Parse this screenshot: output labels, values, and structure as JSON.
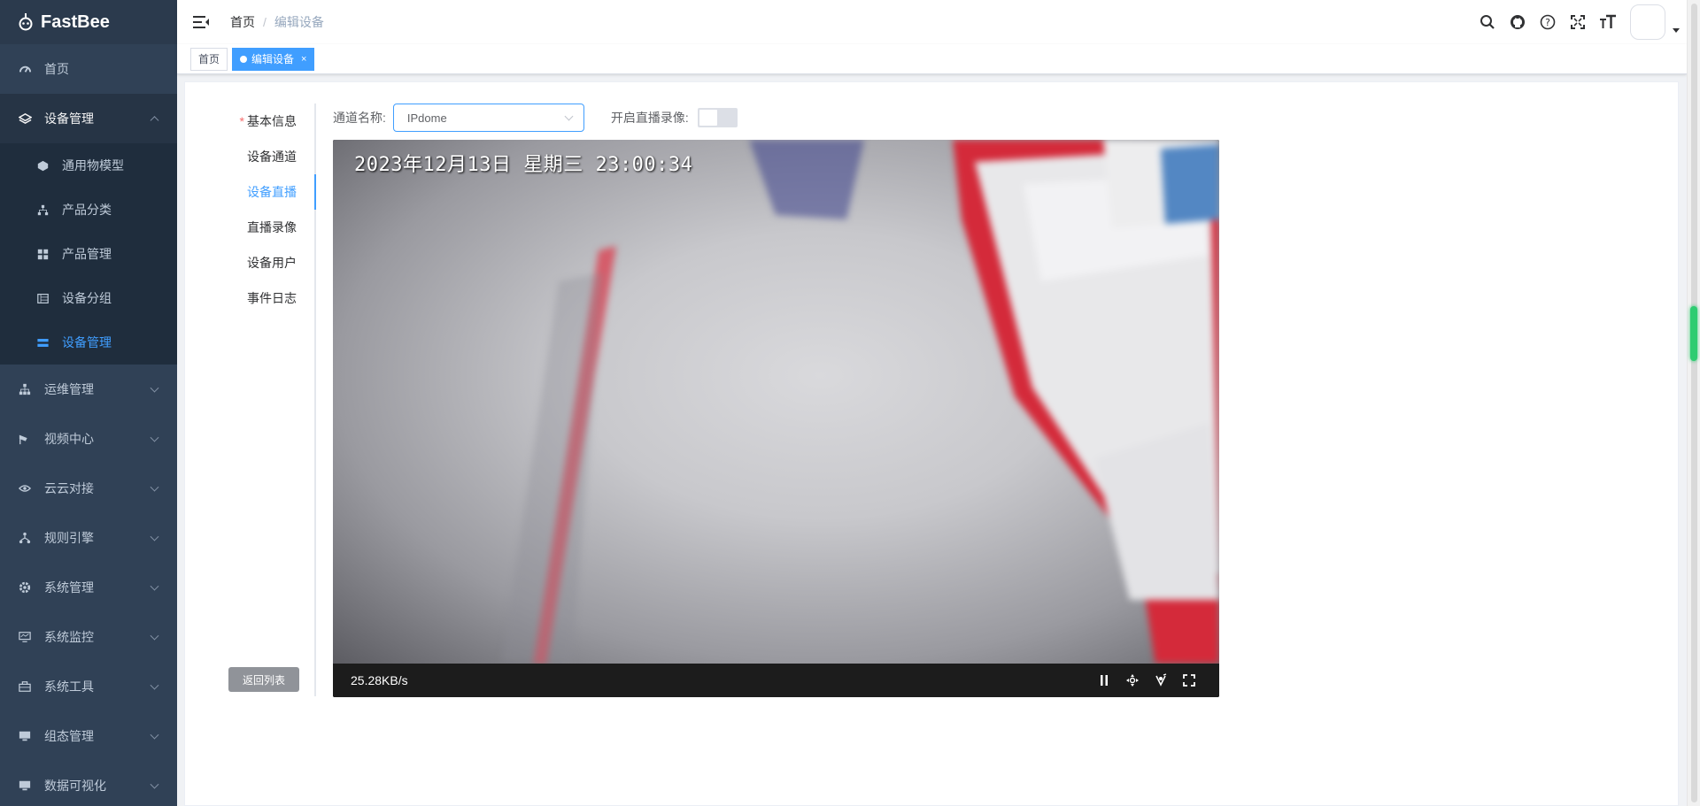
{
  "app": {
    "name": "FastBee"
  },
  "sidebar": {
    "items": [
      {
        "label": "首页",
        "icon": "dashboard-icon"
      },
      {
        "label": "设备管理",
        "icon": "layers-icon",
        "expanded": true,
        "children": [
          {
            "label": "通用物模型",
            "icon": "cube-icon"
          },
          {
            "label": "产品分类",
            "icon": "tree-icon"
          },
          {
            "label": "产品管理",
            "icon": "grid-icon"
          },
          {
            "label": "设备分组",
            "icon": "group-icon"
          },
          {
            "label": "设备管理",
            "icon": "list-icon",
            "active": true
          }
        ]
      },
      {
        "label": "运维管理",
        "icon": "org-icon"
      },
      {
        "label": "视频中心",
        "icon": "camera-icon"
      },
      {
        "label": "云云对接",
        "icon": "eye-icon"
      },
      {
        "label": "规则引擎",
        "icon": "branch-icon"
      },
      {
        "label": "系统管理",
        "icon": "gear-icon"
      },
      {
        "label": "系统监控",
        "icon": "monitor-icon"
      },
      {
        "label": "系统工具",
        "icon": "toolbox-icon"
      },
      {
        "label": "组态管理",
        "icon": "screen-icon"
      },
      {
        "label": "数据可视化",
        "icon": "chart-screen-icon"
      }
    ]
  },
  "header": {
    "breadcrumb": [
      "首页",
      "编辑设备"
    ],
    "right_icons": [
      "search-icon",
      "github-icon",
      "help-icon",
      "fullscreen-icon",
      "font-size-icon"
    ]
  },
  "tags": [
    {
      "label": "首页",
      "active": false
    },
    {
      "label": "编辑设备",
      "active": true,
      "close": "×"
    }
  ],
  "tabs": {
    "items": [
      {
        "label": "基本信息",
        "required": "*"
      },
      {
        "label": "设备通道"
      },
      {
        "label": "设备直播",
        "active": true
      },
      {
        "label": "直播录像"
      },
      {
        "label": "设备用户"
      },
      {
        "label": "事件日志"
      }
    ],
    "back_button": "返回列表"
  },
  "form": {
    "channel_label": "通道名称:",
    "channel_value": "IPdome",
    "record_label": "开启直播录像:",
    "record_enabled": false
  },
  "player": {
    "osd_text": "2023年12月13日 星期三 23:00:34",
    "rate": "25.28KB/s",
    "controls": [
      "pause-icon",
      "ptz-icon",
      "screenshot-icon",
      "fullscreen-icon"
    ]
  },
  "colors": {
    "accent": "#409eff",
    "sidebar_bg": "#304156",
    "submenu_bg": "#1f2d3d"
  }
}
